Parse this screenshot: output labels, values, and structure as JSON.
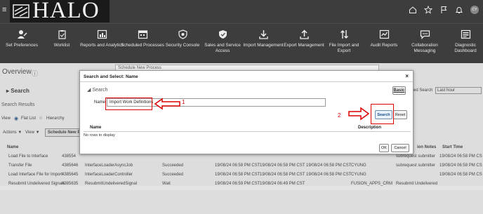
{
  "brand": {
    "logo_text": "HALO"
  },
  "header_icons": [
    "home-icon",
    "star-icon",
    "flag-icon",
    "bell-icon"
  ],
  "user": {
    "initials": "CY"
  },
  "nav": [
    {
      "label": "Set Preferences",
      "icon": "user-edit-icon"
    },
    {
      "label": "Worklist",
      "icon": "clipboard-icon"
    },
    {
      "label": "Reports and Analytics",
      "icon": "report-icon"
    },
    {
      "label": "Scheduled Processes",
      "icon": "calendar-icon"
    },
    {
      "label": "Security Console",
      "icon": "shield-icon"
    },
    {
      "label": "Sales and Service Access",
      "icon": "shield-check-icon"
    },
    {
      "label": "Import Management",
      "icon": "download-icon"
    },
    {
      "label": "Export Management",
      "icon": "upload-icon"
    },
    {
      "label": "File Import and Export",
      "icon": "transfer-icon"
    },
    {
      "label": "Audit Reports",
      "icon": "audit-icon"
    },
    {
      "label": "Collaboration Messaging",
      "icon": "chat-icon"
    },
    {
      "label": "Diagnostic Dashboard",
      "icon": "dashboard-icon"
    }
  ],
  "background": {
    "overview": "Overview",
    "search": "Search",
    "search_results": "Search Results",
    "view_label": "View",
    "flat_list": "Flat List",
    "hierarchy": "Hierarchy",
    "actions": "Actions ▼",
    "view_menu": "View ▼",
    "schedule_btn": "Schedule New P",
    "col_name": "Name",
    "behind_dialog_title": "Schedule New Process",
    "time_range_label": "ed Search",
    "time_range_value": "Last hour",
    "col_notes": "ion Notes",
    "col_start": "Start Time",
    "rows": [
      {
        "name": "Load File to Interface",
        "id": "438554",
        "notes": "subrequest submitter",
        "start": "19/08/24 06:58 PM CS"
      },
      {
        "name": "Transfer File",
        "id": "4385646",
        "proc": "InterfaceLoaderAsyncJob",
        "status": "Succeeded",
        "t1": "19/08/24 06:58 PM CST",
        "t2": "19/08/24 06:58 PM CST",
        "t3": "19/08/24 06:58 PM CST",
        "user": "CYUNG",
        "notes": "subrequest submitter",
        "start": "19/08/24 06:58 PM CS"
      },
      {
        "name": "Load Interface File for Import",
        "id": "4385645",
        "proc": "InterfaceLoaderController",
        "status": "Succeeded",
        "t1": "19/08/24 06:58 PM CST",
        "t2": "19/08/24 06:58 PM CST",
        "t3": "19/08/24 06:58 PM CST",
        "user": "CYUNG",
        "notes": "",
        "start": "19/08/24 06:58 PM CS"
      },
      {
        "name": "Resubmit Undelivered Signals",
        "id": "4385635",
        "proc": "ResubmitUndeliveredSignal",
        "status": "Wait",
        "t1": "19/08/24 06:59 PM CST",
        "t2": "19/08/24 06:49 PM CST",
        "t3": "",
        "user": "FUSION_APPS_CRM",
        "notes": "Resubmit Undelivered",
        "start": ""
      }
    ]
  },
  "dialog": {
    "title": "Search and Select: Name",
    "close": "×",
    "search_section": "Search",
    "basic_btn": "Basic",
    "name_label": "Name",
    "name_value": "Import Work Definitions",
    "search_btn": "Search",
    "reset_btn": "Reset",
    "col_name": "Name",
    "col_description": "Description",
    "no_rows": "No rows to display",
    "ok_btn": "OK",
    "cancel_btn": "Cancel"
  },
  "annotations": {
    "step1": "1",
    "step2": "2",
    "color": "#d00000"
  }
}
